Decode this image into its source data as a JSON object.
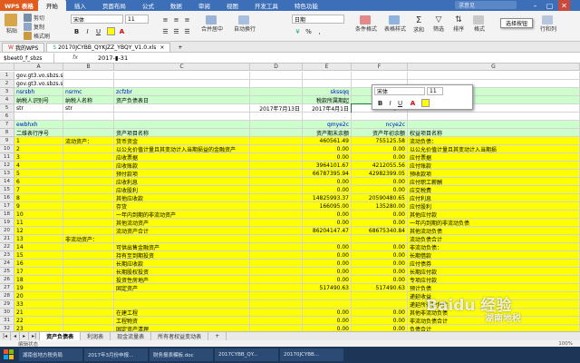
{
  "window": {
    "app_name": "WPS 表格",
    "ask_placeholder": "求意见",
    "min": "–",
    "max": "▢",
    "close": "✕"
  },
  "menu": [
    "开始",
    "插入",
    "页面布局",
    "公式",
    "数据",
    "审阅",
    "视图",
    "开发工具",
    "特色功能"
  ],
  "ribbon": {
    "paste": "粘贴",
    "cut": "剪切",
    "copy": "复制",
    "format_painter": "格式刷",
    "font_name": "宋体",
    "font_size": "11",
    "bold": "B",
    "italic": "I",
    "underline": "U",
    "merge": "合并居中",
    "wrap": "自动换行",
    "number_format": "日期",
    "conditional": "条件格式",
    "table_style": "表格样式",
    "sum": "求和",
    "filter": "筛选",
    "sort": "排序",
    "format": "格式",
    "rows_cols": "行和列",
    "tooltip": "选择按钮"
  },
  "doc_tabs": [
    "我的WPS",
    "20170JCYBB_QYKJZZ_YBQY_V1.0.xls"
  ],
  "formula_bar": {
    "name_box": "$beet0_f_sbzs",
    "fx": "fx",
    "value": "2017-▮-31"
  },
  "columns": [
    "A",
    "B",
    "C",
    "D",
    "E",
    "F",
    "G"
  ],
  "rows": [
    {
      "n": "1",
      "cells": [
        "gov.gt3.vo.sbzs.sb.sb099.Ybqykjzzcwbybw",
        "",
        "",
        "",
        "",
        "",
        ""
      ]
    },
    {
      "n": "2",
      "cells": [
        "gov.gt3.vo.sbzs.sb.sb099.Ybqyzcfzbzb0ridlbVO",
        "",
        "",
        "",
        "",
        "",
        ""
      ]
    },
    {
      "n": "3",
      "cells": [
        "nsrsbh",
        "nsrmc",
        "zcfzbr",
        "",
        "skssqq",
        "skssq",
        ""
      ]
    },
    {
      "n": "4",
      "cells": [
        "纳税人识别号",
        "纳税人名称",
        "资产负债表日",
        "",
        "税款所属期起",
        "税款所",
        ""
      ]
    },
    {
      "n": "5",
      "cells": [
        "str",
        "str",
        "",
        "2017年7月13日",
        "2017年4月1日",
        "2017-▮-31",
        ""
      ]
    },
    {
      "n": "6",
      "cells": [
        "",
        "",
        "",
        "",
        "",
        "",
        ""
      ]
    },
    {
      "n": "7",
      "cells": [
        "ewbhxh",
        "",
        "",
        "",
        "qmye2c",
        "ncye2c",
        ""
      ]
    },
    {
      "n": "8",
      "cells": [
        "二维表行序号",
        "",
        "资产项目名称",
        "",
        "资产期末余额",
        "资产年初余额",
        "权益项目名称"
      ]
    },
    {
      "n": "9",
      "cells": [
        "1",
        "流动资产：",
        "货币资金",
        "",
        "460561.49",
        "755125.58",
        "流动负债："
      ]
    },
    {
      "n": "10",
      "cells": [
        "2",
        "",
        "以公允价值计量且其变动计入当期损益的金融资产",
        "",
        "0.00",
        "0.00",
        "以公允价值计量且其变动计入当期损"
      ]
    },
    {
      "n": "11",
      "cells": [
        "3",
        "",
        "应收票据",
        "",
        "0.00",
        "0.00",
        "应付票据"
      ]
    },
    {
      "n": "12",
      "cells": [
        "4",
        "",
        "应收账款",
        "",
        "3964101.67",
        "4212055.56",
        "应付账款"
      ]
    },
    {
      "n": "13",
      "cells": [
        "5",
        "",
        "预付款项",
        "",
        "66787395.94",
        "42982399.05",
        "预收款项"
      ]
    },
    {
      "n": "14",
      "cells": [
        "6",
        "",
        "应收利息",
        "",
        "0.00",
        "0.00",
        "应付职工薪酬"
      ]
    },
    {
      "n": "15",
      "cells": [
        "7",
        "",
        "应收股利",
        "",
        "0.00",
        "0.00",
        "应交税费"
      ]
    },
    {
      "n": "16",
      "cells": [
        "8",
        "",
        "其他应收款",
        "",
        "14825993.37",
        "20590480.65",
        "应付利息"
      ]
    },
    {
      "n": "17",
      "cells": [
        "9",
        "",
        "存货",
        "",
        "166095.00",
        "135280.00",
        "应付股利"
      ]
    },
    {
      "n": "18",
      "cells": [
        "10",
        "",
        "一年内到期的非流动资产",
        "",
        "0.00",
        "0.00",
        "其他应付款"
      ]
    },
    {
      "n": "19",
      "cells": [
        "11",
        "",
        "其他流动资产",
        "",
        "0.00",
        "0.00",
        "一年内到期的非流动负债"
      ]
    },
    {
      "n": "20",
      "cells": [
        "12",
        "",
        "流动资产合计",
        "",
        "86204147.47",
        "68675340.84",
        "其他流动负债"
      ]
    },
    {
      "n": "21",
      "cells": [
        "13",
        "非流动资产：",
        "",
        "",
        "",
        "",
        "流动负债合计"
      ]
    },
    {
      "n": "22",
      "cells": [
        "14",
        "",
        "可供出售金融资产",
        "",
        "0.00",
        "0.00",
        "非流动负债："
      ]
    },
    {
      "n": "23",
      "cells": [
        "15",
        "",
        "持有至到期投资",
        "",
        "0.00",
        "0.00",
        "长期借款"
      ]
    },
    {
      "n": "24",
      "cells": [
        "16",
        "",
        "长期应收款",
        "",
        "0.00",
        "0.00",
        "应付债券"
      ]
    },
    {
      "n": "25",
      "cells": [
        "17",
        "",
        "长期股权投资",
        "",
        "0.00",
        "0.00",
        "长期应付款"
      ]
    },
    {
      "n": "26",
      "cells": [
        "18",
        "",
        "投资性房地产",
        "",
        "0.00",
        "0.00",
        "专项应付款"
      ]
    },
    {
      "n": "27",
      "cells": [
        "19",
        "",
        "固定资产",
        "",
        "517490.63",
        "517490.63",
        "预计负债"
      ]
    },
    {
      "n": "28",
      "cells": [
        "20",
        "",
        "",
        "",
        "",
        "",
        "递延收益"
      ]
    },
    {
      "n": "29",
      "cells": [
        "33",
        "",
        "",
        "",
        "",
        "",
        "递延所得税负债"
      ]
    },
    {
      "n": "30",
      "cells": [
        "21",
        "",
        "在建工程",
        "",
        "0.00",
        "0.00",
        "其他非流动负债"
      ]
    },
    {
      "n": "31",
      "cells": [
        "22",
        "",
        "工程物资",
        "",
        "0.00",
        "0.00",
        "非流动负债合计"
      ]
    },
    {
      "n": "32",
      "cells": [
        "23",
        "",
        "固定资产清理",
        "",
        "0.00",
        "0.00",
        "负债合计"
      ]
    }
  ],
  "mini_toolbar": {
    "font": "宋体",
    "size": "11",
    "b": "B",
    "i": "I",
    "u": "U"
  },
  "sheet_tabs": [
    "资产负债表",
    "利润表",
    "现金流量表",
    "所有者权益变动表"
  ],
  "status": {
    "left": "编辑状态",
    "zoom": "100%"
  },
  "taskbar": [
    "湖南省地方税务局",
    "2017年3月份申报...",
    "财务报表模板.doc",
    "2017CYBB_QY...",
    "20170JCYBB..."
  ],
  "watermark": {
    "line1": "Baidu 经验",
    "line2": "湖南地税"
  },
  "colors": {
    "yellow": "#ffff00",
    "green_header": "#ccffcc",
    "title_blue": "#3c6fb8"
  }
}
